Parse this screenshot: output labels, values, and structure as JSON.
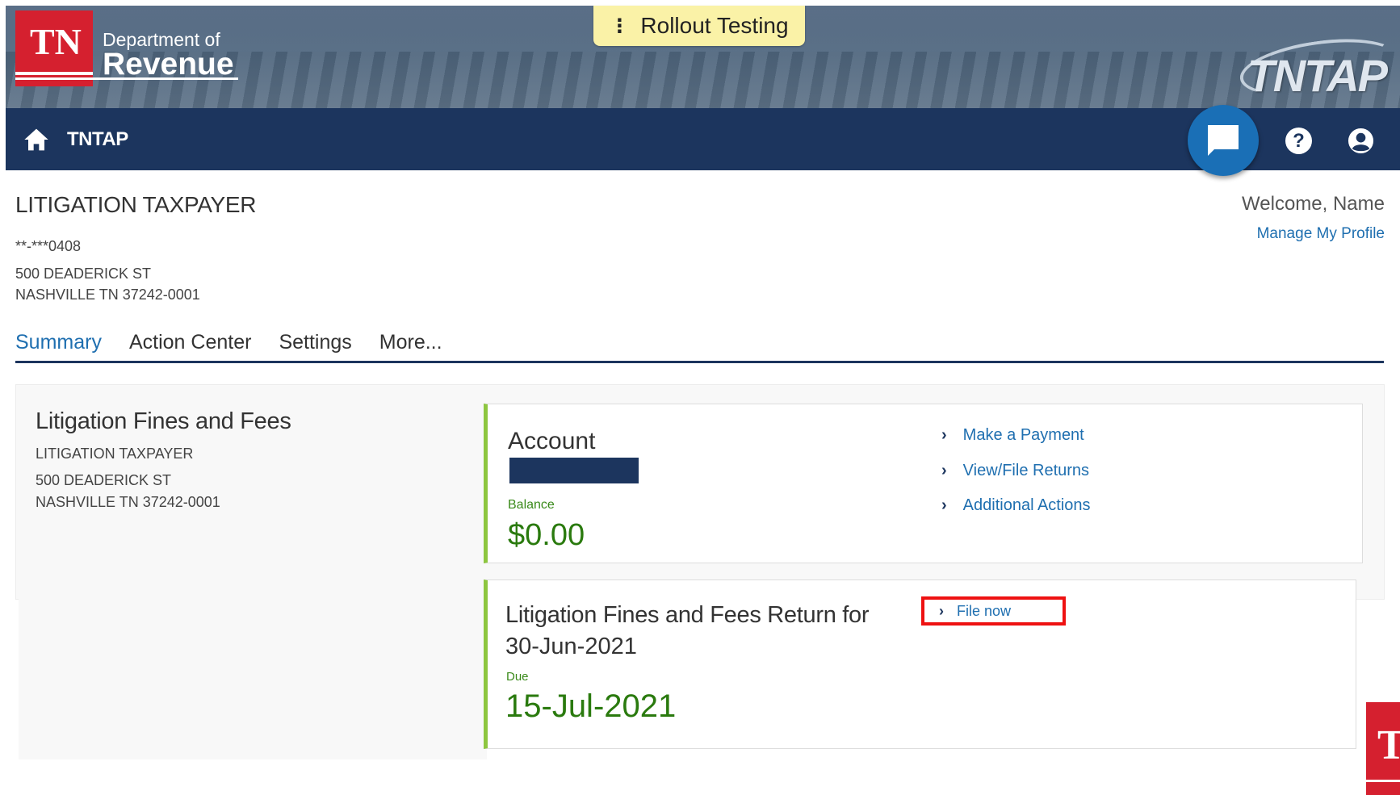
{
  "header": {
    "logo_abbrev": "TN",
    "logo_line1": "Department of",
    "logo_line2": "Revenue",
    "rollout_label": "Rollout Testing",
    "brand": "TNTAP"
  },
  "navbar": {
    "home_label": "TNTAP",
    "icons": [
      "home-icon",
      "chat-icon",
      "help-icon",
      "user-icon"
    ]
  },
  "taxpayer": {
    "name": "LITIGATION TAXPAYER",
    "tin": "**-***0408",
    "address_line1": "500 DEADERICK ST",
    "address_line2": "NASHVILLE TN 37242-0001"
  },
  "user": {
    "welcome": "Welcome, Name",
    "manage_profile": "Manage My Profile"
  },
  "tabs": [
    {
      "label": "Summary",
      "active": true
    },
    {
      "label": "Action Center",
      "active": false
    },
    {
      "label": "Settings",
      "active": false
    },
    {
      "label": "More...",
      "active": false
    }
  ],
  "summary": {
    "title": "Litigation Fines and Fees",
    "taxpayer_name": "LITIGATION TAXPAYER",
    "address_line1": "500 DEADERICK ST",
    "address_line2": "NASHVILLE TN 37242-0001"
  },
  "account": {
    "title": "Account",
    "balance_label": "Balance",
    "balance_value": "$0.00",
    "actions": [
      "Make a Payment",
      "View/File Returns",
      "Additional Actions"
    ]
  },
  "return": {
    "title_line1": "Litigation Fines and Fees Return for",
    "title_line2": "30-Jun-2021",
    "due_label": "Due",
    "due_value": "15-Jul-2021",
    "action": "File now"
  },
  "colors": {
    "navy": "#1c355e",
    "link": "#1f6fb0",
    "green": "#2a7a0e",
    "accent_green": "#8dc63f",
    "brand_red": "#d5202f",
    "highlight": "#ee1111"
  }
}
